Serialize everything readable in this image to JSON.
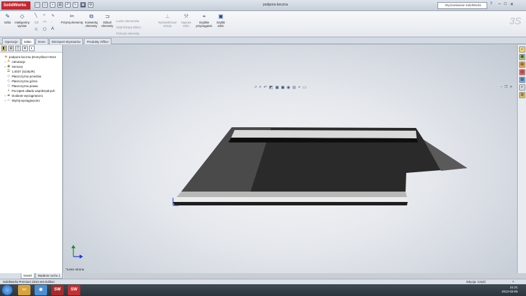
{
  "titlebar": {
    "logo": "SolidWorks",
    "document_title": "podpora boczna",
    "search_placeholder": "Wyszukiwanie SolidWorks",
    "help_icon": "help-icon"
  },
  "ribbon": {
    "sketch_label": "Szkic",
    "smart_dim_label": "Inteligentny wymiar",
    "trim_label": "Przytnij elementy",
    "convert_label": "Konwertuj elementy",
    "offset_label": "Odsuń elementy",
    "mirror_label": "Lustro elementów",
    "linear_pattern_label": "Szyk liniowy szkicu",
    "move_label": "Przesuń elementy",
    "display_relations_label": "Wyświetl/usuń relacje",
    "repair_label": "Napraw szkic",
    "quick_snaps_label": "Szybkie przyciąganie",
    "rapid_sketch_label": "Szybki szkic"
  },
  "tabs": [
    {
      "label": "Operacje",
      "active": false
    },
    {
      "label": "Szkic",
      "active": true
    },
    {
      "label": "Ocen",
      "active": false
    },
    {
      "label": "DimXpert Wymiarów",
      "active": false
    },
    {
      "label": "Produkty Office",
      "active": false
    }
  ],
  "feature_tree": [
    {
      "label": "podpora boczna  (Domyślna<<Dom",
      "icon": "part-icon",
      "indent": 0,
      "expander": ""
    },
    {
      "label": "Adnotacje",
      "icon": "annotations-icon",
      "indent": 1,
      "expander": "+"
    },
    {
      "label": "Sensory",
      "icon": "sensors-icon",
      "indent": 1,
      "expander": "+"
    },
    {
      "label": "1.0037 (S235JR)",
      "icon": "material-icon",
      "indent": 1,
      "expander": ""
    },
    {
      "label": "Płaszczyzna przednia",
      "icon": "plane-icon",
      "indent": 1,
      "expander": ""
    },
    {
      "label": "Płaszczyzna górna",
      "icon": "plane-icon",
      "indent": 1,
      "expander": ""
    },
    {
      "label": "Płaszczyzna prawa",
      "icon": "plane-icon",
      "indent": 1,
      "expander": ""
    },
    {
      "label": "Początek układu współrzędnych",
      "icon": "origin-icon",
      "indent": 1,
      "expander": ""
    },
    {
      "label": "Dodanie-wyciągnięcie1",
      "icon": "extrude-icon",
      "indent": 1,
      "expander": "+"
    },
    {
      "label": "Wytnij-wyciągnięcie1",
      "icon": "cut-extrude-icon",
      "indent": 1,
      "expander": "+"
    }
  ],
  "bottom_tabs": [
    {
      "label": "Model",
      "active": true
    },
    {
      "label": "Badanie ruchu 1",
      "active": false
    }
  ],
  "graphics": {
    "view_name": "*Lewo strona"
  },
  "statusbar": {
    "left": "SolidWorks Premium 2010 x64 Edition",
    "right": "Edycja: Część",
    "help": "?"
  },
  "taskbar": {
    "time": "21:21",
    "date": "2012-03-05"
  },
  "colors": {
    "accent": "#c8262e",
    "body_dark": "#262626"
  }
}
